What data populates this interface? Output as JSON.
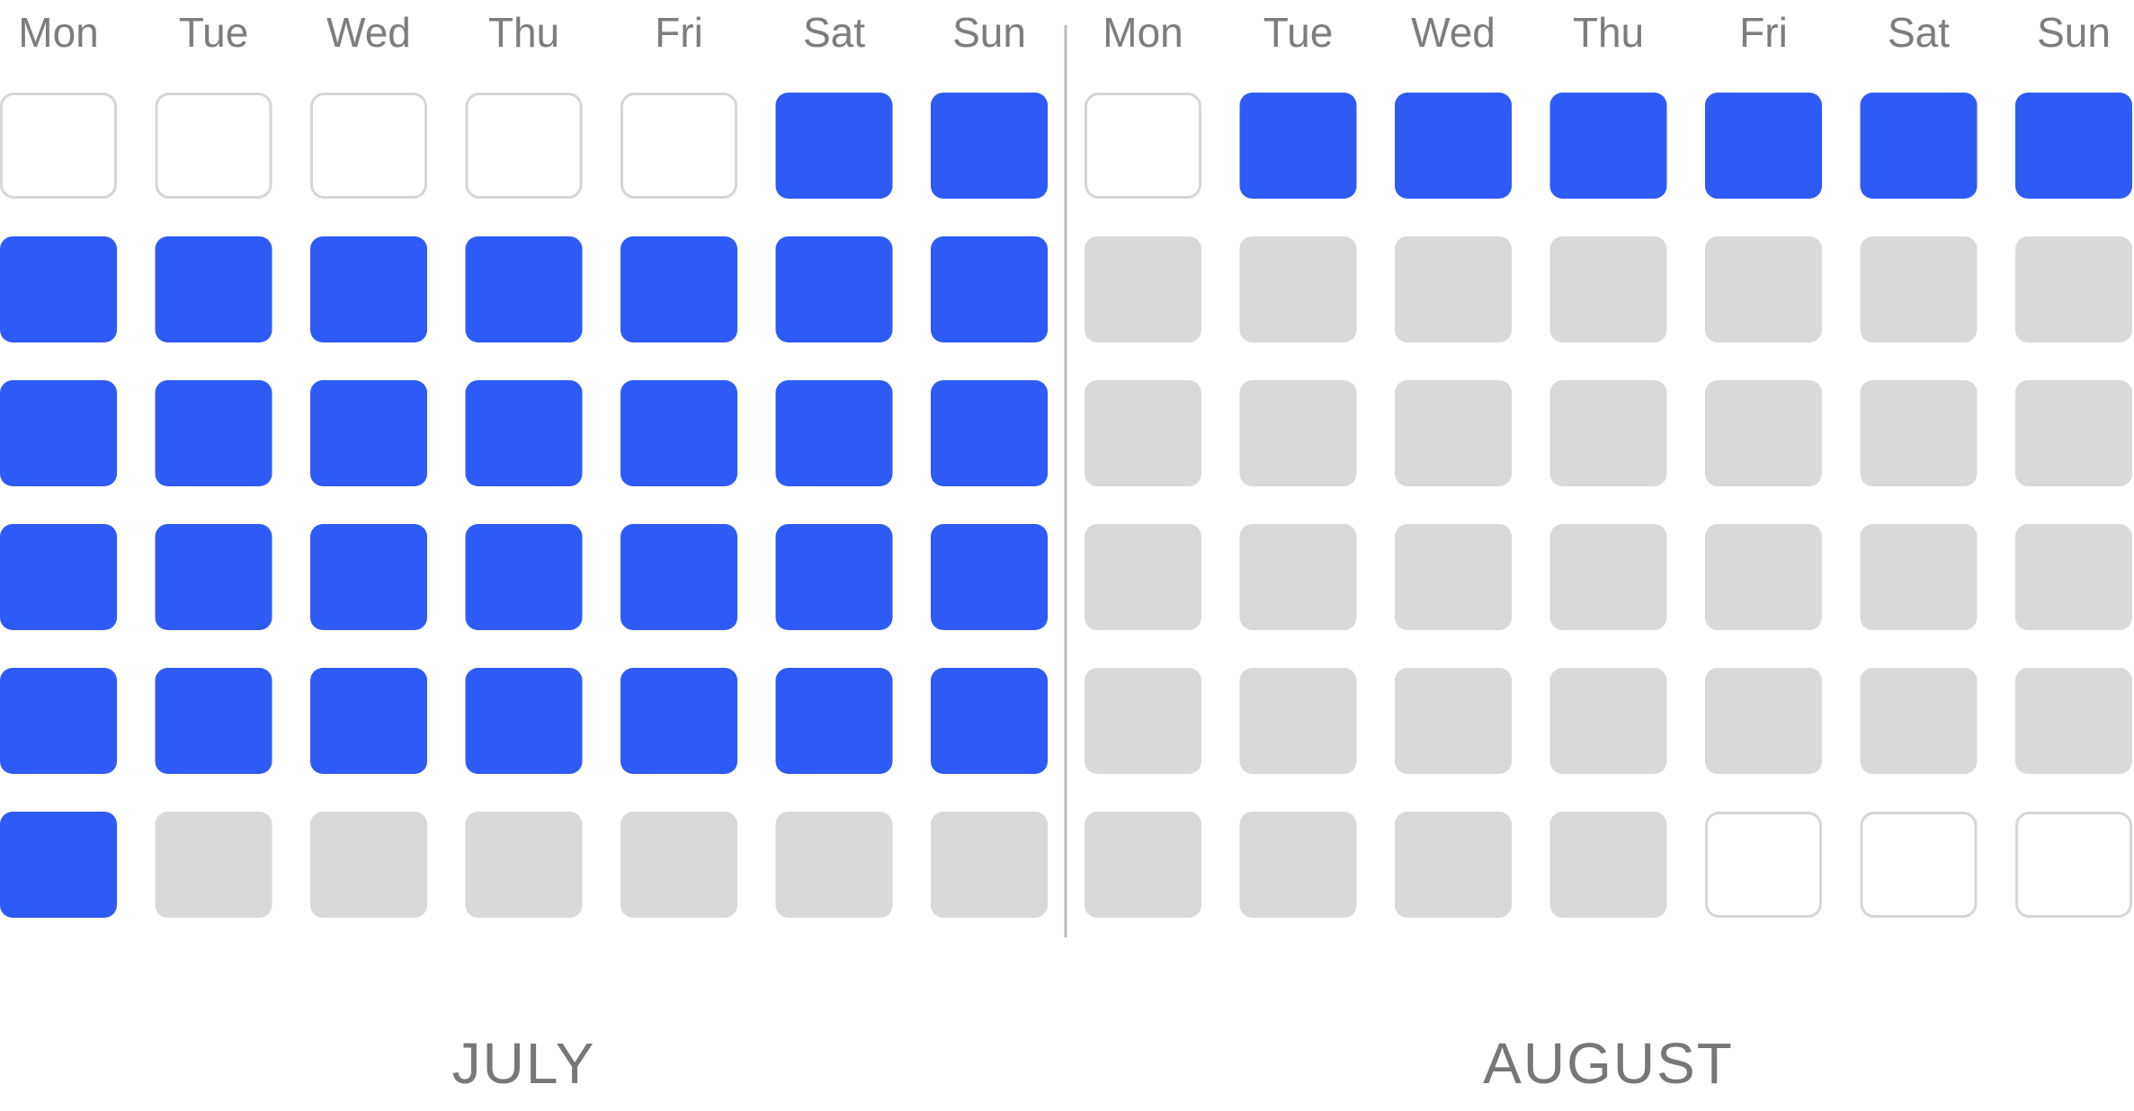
{
  "chart_data": {
    "type": "heatmap",
    "colors": {
      "done": "#2e5af5",
      "remaining": "#d9d9d9",
      "outside": "#ffffff",
      "outside_border": "#d6d6d6",
      "divider": "#bdbdbd",
      "text": "#7d7d7d"
    },
    "legend_states": [
      "outside",
      "done",
      "remaining"
    ],
    "months": [
      {
        "name": "JULY",
        "weekdays": [
          "Mon",
          "Tue",
          "Wed",
          "Thu",
          "Fri",
          "Sat",
          "Sun"
        ],
        "weeks": [
          [
            "outside",
            "outside",
            "outside",
            "outside",
            "outside",
            "done",
            "done"
          ],
          [
            "done",
            "done",
            "done",
            "done",
            "done",
            "done",
            "done"
          ],
          [
            "done",
            "done",
            "done",
            "done",
            "done",
            "done",
            "done"
          ],
          [
            "done",
            "done",
            "done",
            "done",
            "done",
            "done",
            "done"
          ],
          [
            "done",
            "done",
            "done",
            "done",
            "done",
            "done",
            "done"
          ],
          [
            "done",
            "remaining",
            "remaining",
            "remaining",
            "remaining",
            "remaining",
            "remaining"
          ]
        ]
      },
      {
        "name": "AUGUST",
        "weekdays": [
          "Mon",
          "Tue",
          "Wed",
          "Thu",
          "Fri",
          "Sat",
          "Sun"
        ],
        "weeks": [
          [
            "outside",
            "done",
            "done",
            "done",
            "done",
            "done",
            "done"
          ],
          [
            "remaining",
            "remaining",
            "remaining",
            "remaining",
            "remaining",
            "remaining",
            "remaining"
          ],
          [
            "remaining",
            "remaining",
            "remaining",
            "remaining",
            "remaining",
            "remaining",
            "remaining"
          ],
          [
            "remaining",
            "remaining",
            "remaining",
            "remaining",
            "remaining",
            "remaining",
            "remaining"
          ],
          [
            "remaining",
            "remaining",
            "remaining",
            "remaining",
            "remaining",
            "remaining",
            "remaining"
          ],
          [
            "remaining",
            "remaining",
            "remaining",
            "remaining",
            "outside",
            "outside",
            "outside"
          ]
        ]
      }
    ]
  }
}
